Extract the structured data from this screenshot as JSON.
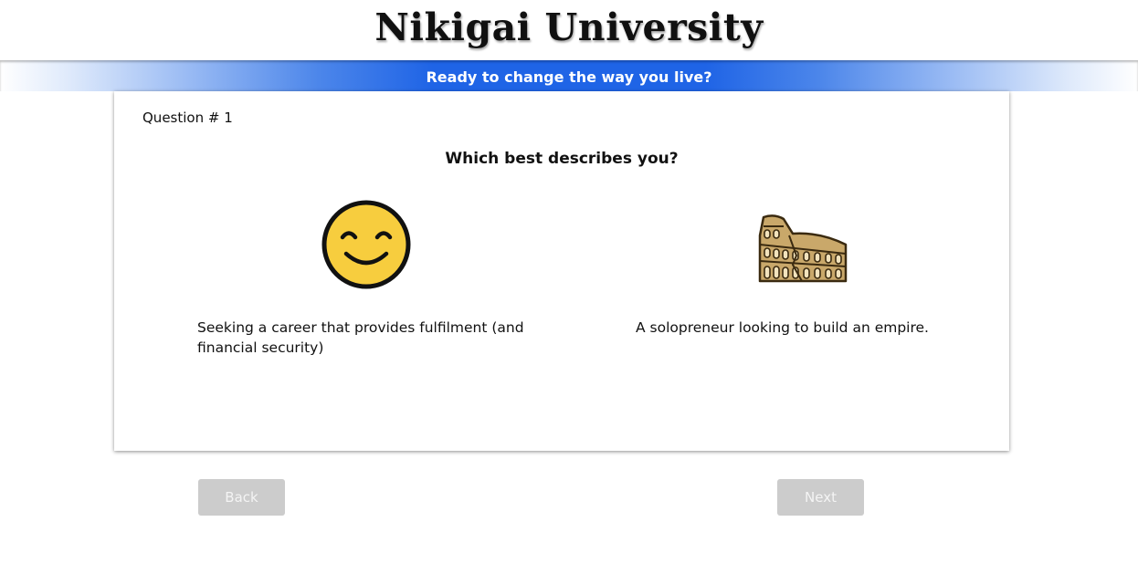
{
  "header": {
    "site_title": "Nikigai University",
    "banner_text": "Ready to change the way you live?"
  },
  "question": {
    "number_label": "Question # 1",
    "text": "Which best describes you?",
    "options": [
      {
        "icon": "smiling-face-icon",
        "label": "Seeking a career that provides fulfilment (and financial security)"
      },
      {
        "icon": "colosseum-icon",
        "label": "A solopreneur looking to build an empire."
      }
    ]
  },
  "navigation": {
    "back_label": "Back",
    "next_label": "Next"
  },
  "colors": {
    "banner_blue": "#1f64e6",
    "button_disabled": "#cccccc",
    "emoji_yellow": "#f7cd3e"
  }
}
